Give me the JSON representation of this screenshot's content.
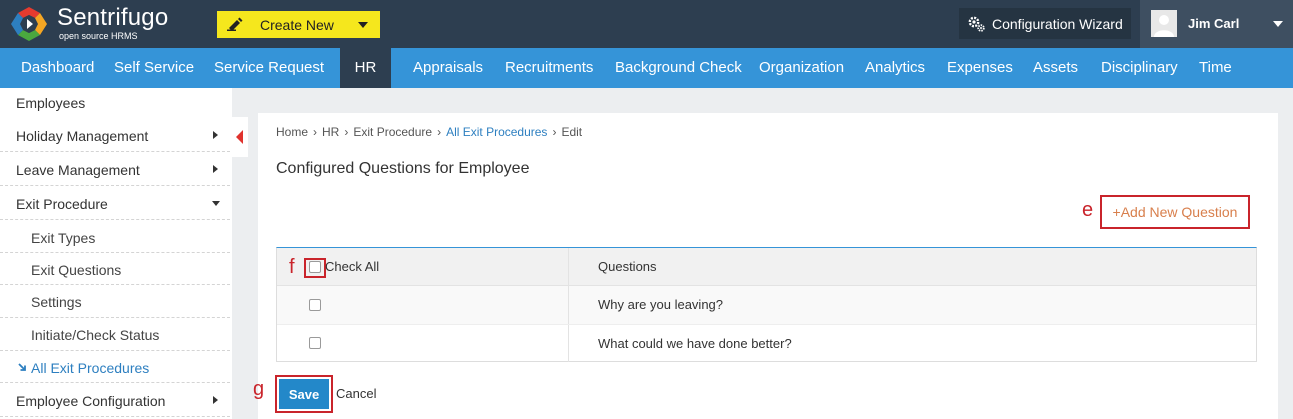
{
  "header": {
    "brand_name": "Sentrifugo",
    "brand_tagline": "open source HRMS",
    "create_new_label": "Create New",
    "config_wizard_label": "Configuration Wizard",
    "user_name": "Jim Carl"
  },
  "nav": {
    "items": [
      {
        "label": "Dashboard"
      },
      {
        "label": "Self Service"
      },
      {
        "label": "Service Request"
      },
      {
        "label": "HR",
        "active": true
      },
      {
        "label": "Appraisals"
      },
      {
        "label": "Recruitments"
      },
      {
        "label": "Background Check"
      },
      {
        "label": "Organization"
      },
      {
        "label": "Analytics"
      },
      {
        "label": "Expenses"
      },
      {
        "label": "Assets"
      },
      {
        "label": "Disciplinary"
      },
      {
        "label": "Time"
      }
    ]
  },
  "sidebar": {
    "items": [
      {
        "label": "Employees"
      },
      {
        "label": "Holiday Management"
      },
      {
        "label": "Leave Management"
      },
      {
        "label": "Exit Procedure"
      },
      {
        "label": "Exit Types"
      },
      {
        "label": "Exit Questions"
      },
      {
        "label": "Settings"
      },
      {
        "label": "Initiate/Check Status"
      },
      {
        "label": "All Exit Procedures",
        "icon": "arrow-down-right-icon"
      },
      {
        "label": "Employee Configuration"
      }
    ]
  },
  "breadcrumb": {
    "home": "Home",
    "hr": "HR",
    "exit_procedure": "Exit Procedure",
    "all_exit": "All Exit Procedures",
    "edit": "Edit",
    "separator": "›"
  },
  "page": {
    "title": "Configured Questions for Employee",
    "add_question_label": "+Add New Question",
    "markers": {
      "e": "e",
      "f": "f",
      "g": "g"
    }
  },
  "table": {
    "check_all_label": "Check All",
    "questions_header": "Questions",
    "rows": [
      {
        "question": "Why are you leaving?"
      },
      {
        "question": "What could we have done better?"
      }
    ]
  },
  "actions": {
    "save_label": "Save",
    "cancel_label": "Cancel"
  },
  "colors": {
    "topbar": "#2d3e50",
    "nav": "#3594d8",
    "create_button": "#f5e71d",
    "highlight_box": "#c9242b",
    "save_button": "#2388c9"
  }
}
